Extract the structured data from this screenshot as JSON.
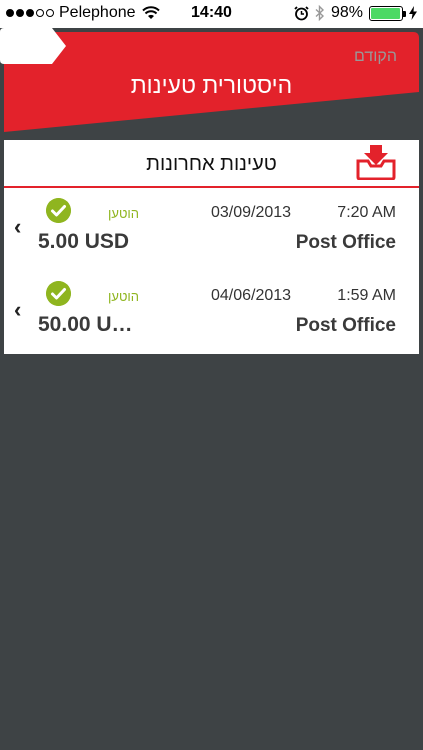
{
  "statusbar": {
    "carrier": "Pelephone",
    "time": "14:40",
    "battery": "98%",
    "battery_level": 0.98
  },
  "header": {
    "title": "היסטורית טעינות",
    "back_label": "הקודם"
  },
  "section": {
    "title": "טעינות אחרונות"
  },
  "transactions": [
    {
      "status": "הוטען",
      "date": "03/09/2013",
      "time": "7:20 AM",
      "amount": "5.00 USD",
      "merchant": "Post Office"
    },
    {
      "status": "הוטען",
      "date": "04/06/2013",
      "time": "1:59 AM",
      "amount": "50.00 U…",
      "merchant": "Post Office"
    }
  ],
  "colors": {
    "accent": "#e3222b",
    "success": "#8fb51f",
    "background": "#3e4345"
  }
}
